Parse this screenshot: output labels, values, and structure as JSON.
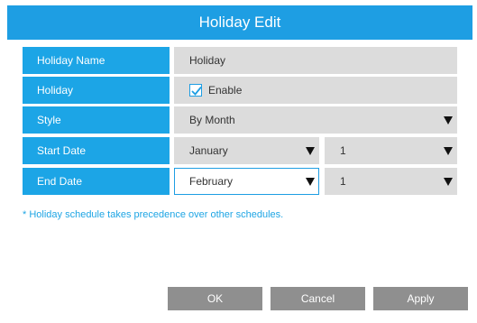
{
  "dialog": {
    "title": "Holiday Edit"
  },
  "form": {
    "holiday_name": {
      "label": "Holiday Name",
      "value": "Holiday"
    },
    "holiday": {
      "label": "Holiday",
      "checkbox_label": "Enable",
      "checked": true
    },
    "style": {
      "label": "Style",
      "value": "By Month"
    },
    "start_date": {
      "label": "Start Date",
      "month": "January",
      "day": "1"
    },
    "end_date": {
      "label": "End Date",
      "month": "February",
      "day": "1"
    }
  },
  "note": "* Holiday schedule takes precedence over other schedules.",
  "buttons": {
    "ok": "OK",
    "cancel": "Cancel",
    "apply": "Apply"
  },
  "colors": {
    "accent": "#1e9ee3",
    "label_bg": "#1ca5e6",
    "field_bg": "#dcdcdc",
    "button_bg": "#8f8f8f"
  }
}
